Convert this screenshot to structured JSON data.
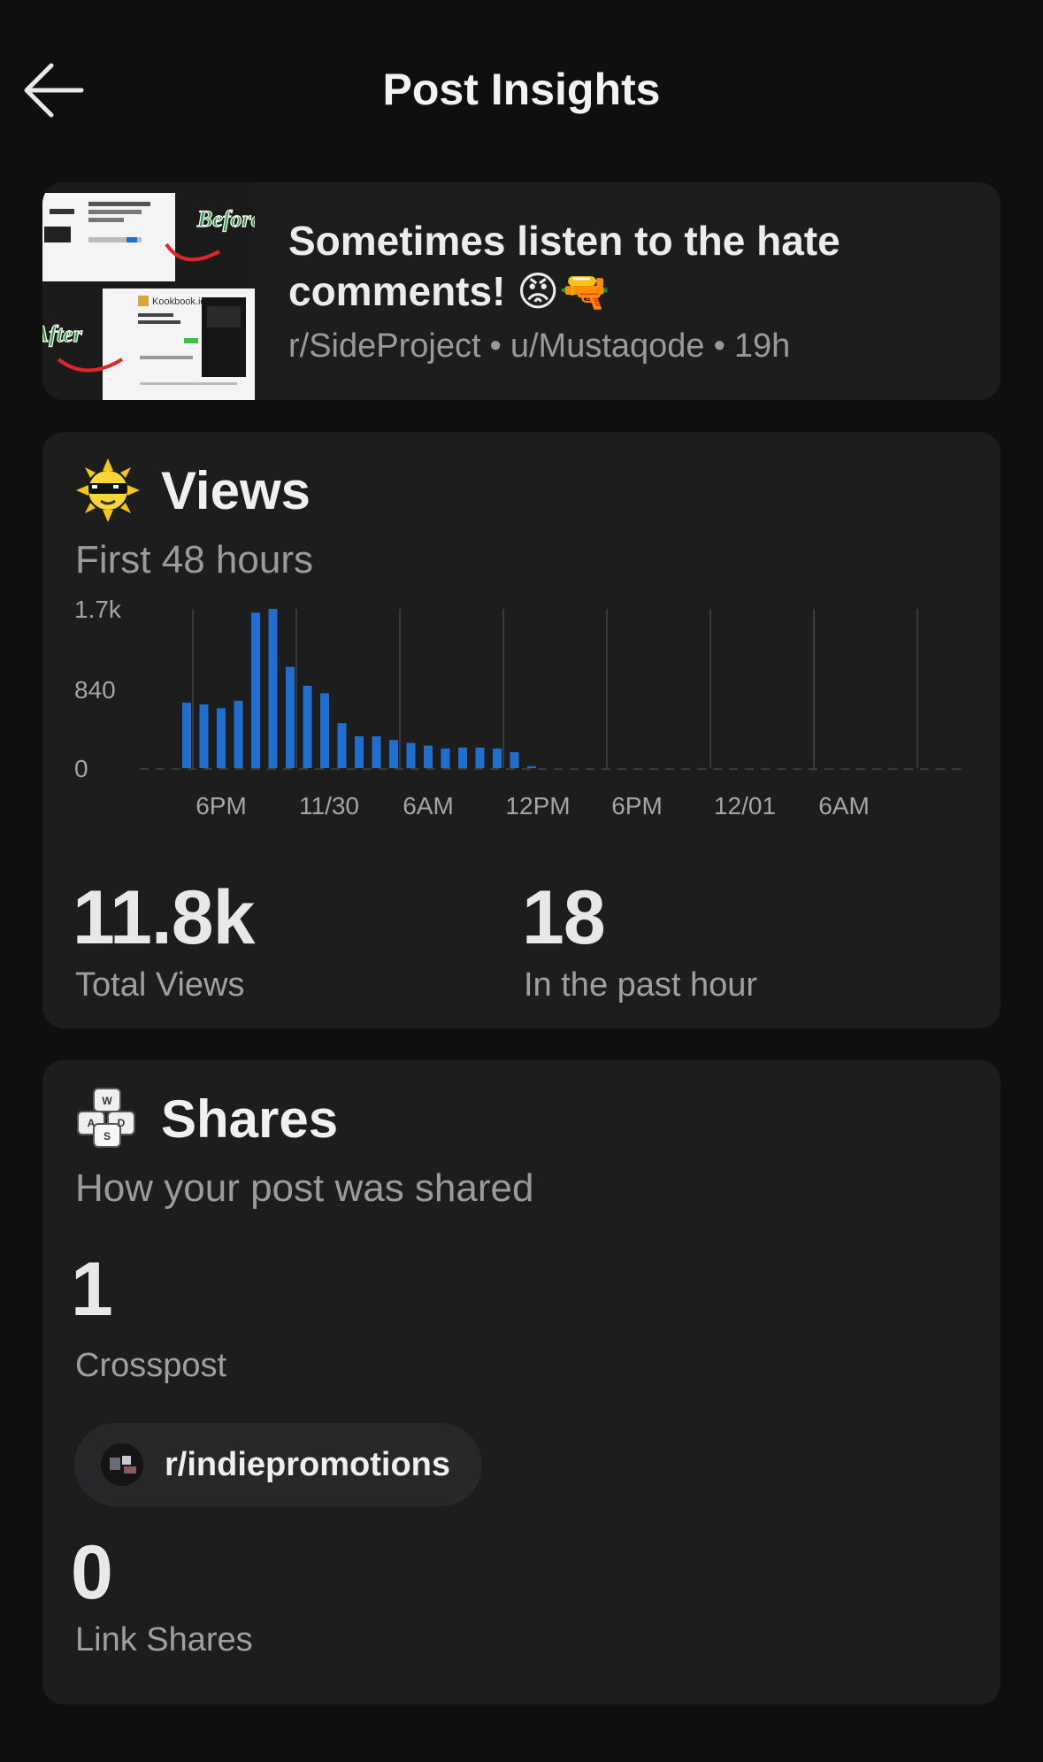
{
  "header": {
    "title": "Post Insights"
  },
  "post": {
    "title": "Sometimes listen to the hate comments! 😡🔫",
    "subreddit": "r/SideProject",
    "author": "u/Mustaqode",
    "age": "19h",
    "thumbnail": {
      "label_before": "Before",
      "label_after": "After",
      "app_name": "Kookbook.io"
    }
  },
  "views": {
    "title": "Views",
    "subtitle": "First 48 hours",
    "total_value": "11.8k",
    "total_label": "Total Views",
    "hour_value": "18",
    "hour_label": "In the past hour"
  },
  "chart_data": {
    "type": "bar",
    "y_ticks": [
      "1.7k",
      "840",
      "0"
    ],
    "ylim": [
      0,
      1700
    ],
    "x_tick_labels": [
      "6PM",
      "11/30",
      "6AM",
      "12PM",
      "6PM",
      "12/01",
      "6AM"
    ],
    "grid": "vertical dashed",
    "values": [
      700,
      680,
      640,
      720,
      1660,
      1700,
      1080,
      880,
      800,
      480,
      340,
      340,
      300,
      270,
      240,
      210,
      220,
      220,
      210,
      170,
      20
    ]
  },
  "shares": {
    "title": "Shares",
    "subtitle": "How your post was shared",
    "crosspost_value": "1",
    "crosspost_label": "Crosspost",
    "crosspost_community": "r/indiepromotions",
    "link_value": "0",
    "link_label": "Link Shares"
  },
  "colors": {
    "background": "#0f0f0f",
    "card": "#1d1d1e",
    "bar": "#1f6fd1"
  },
  "icons": {
    "back": "arrow-left-icon",
    "views": "cool-sun-icon",
    "shares": "keycaps-icon"
  }
}
